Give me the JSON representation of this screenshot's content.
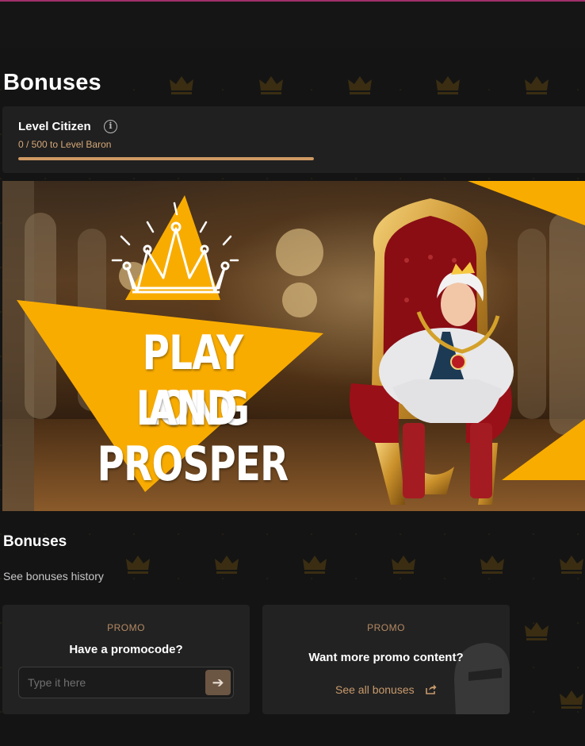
{
  "page": {
    "title": "Bonuses"
  },
  "level": {
    "name": "Level Citizen",
    "progress_text": "0 / 500 to Level Baron",
    "progress_fraction": 1.0,
    "info_icon": "info-icon"
  },
  "banner": {
    "line1": "PLAY LONG",
    "line2": "AND PROSPER"
  },
  "bonuses": {
    "title": "Bonuses",
    "history_link": "See bonuses history"
  },
  "promo_code_card": {
    "eyebrow": "PROMO",
    "heading": "Have a promocode?",
    "input_placeholder": "Type it here",
    "input_value": "",
    "submit_icon": "arrow-right-icon"
  },
  "promo_content_card": {
    "eyebrow": "PROMO",
    "heading": "Want more promo content?",
    "link": "See all bonuses",
    "link_icon": "share-icon"
  },
  "colors": {
    "background": "#141414",
    "card": "#202020",
    "accent_gold": "#cf9a63",
    "banner_yellow": "#f9ac00",
    "top_accent": "#a0306a"
  }
}
